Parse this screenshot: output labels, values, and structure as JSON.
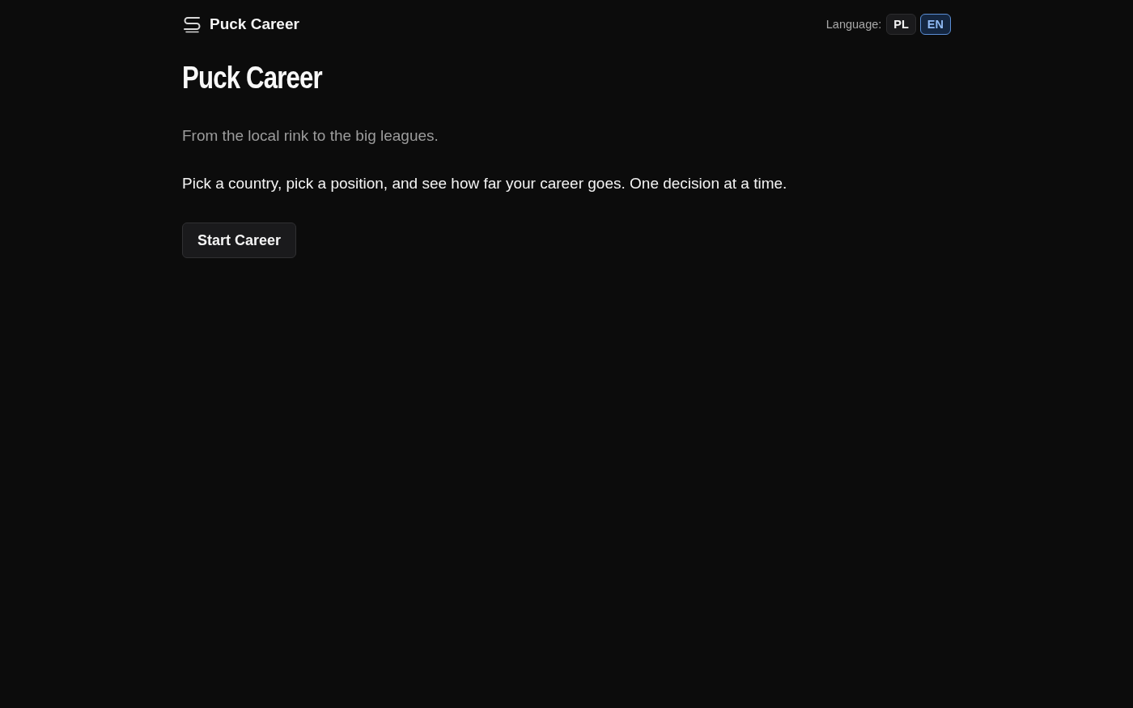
{
  "header": {
    "brand": "Puck Career",
    "language": {
      "label": "Language:",
      "options": [
        {
          "label": "PL",
          "selected": false
        },
        {
          "label": "EN",
          "selected": true
        }
      ]
    }
  },
  "hero": {
    "title": "Puck Career",
    "subtitle": "From the local rink to the big leagues.",
    "description": "Pick a country, pick a position, and see how far your career goes. One decision at a time.",
    "start_button": "Start Career"
  }
}
